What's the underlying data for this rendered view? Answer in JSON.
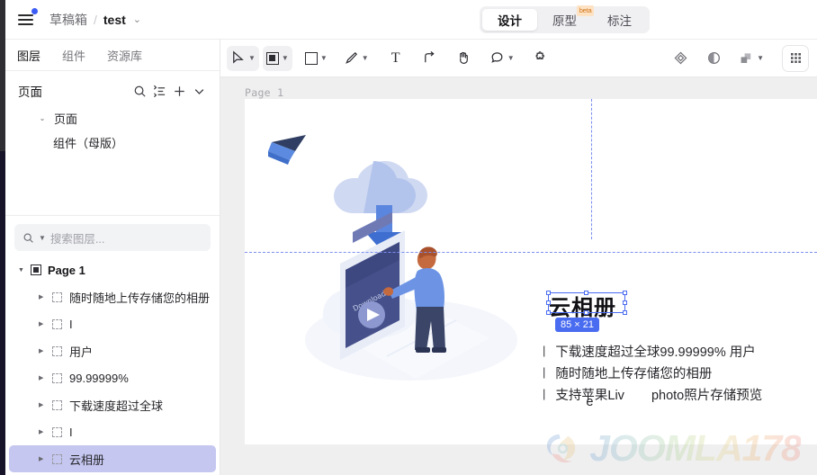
{
  "header": {
    "menu_icon": "hamburger-icon",
    "notification_dot": true,
    "breadcrumb_root": "草稿箱",
    "breadcrumb_sep": "/",
    "breadcrumb_current": "test",
    "breadcrumb_chevron": "⌄",
    "tabs": [
      {
        "label": "设计",
        "active": true,
        "badge": ""
      },
      {
        "label": "原型",
        "active": false,
        "badge": "beta"
      },
      {
        "label": "标注",
        "active": false,
        "badge": ""
      }
    ]
  },
  "left_panel": {
    "tabs": [
      {
        "label": "图层",
        "active": true
      },
      {
        "label": "组件",
        "active": false
      },
      {
        "label": "资源库",
        "active": false
      }
    ],
    "page_section": {
      "title": "页面",
      "icons": [
        "search-icon",
        "sort-list-icon",
        "plus-icon",
        "chevron-down-icon"
      ],
      "items": [
        {
          "label": "页面",
          "caret": "⌄",
          "indent": 1
        },
        {
          "label": "组件（母版）",
          "caret": "",
          "indent": 2
        }
      ]
    },
    "search": {
      "placeholder": "搜索图层...",
      "value": ""
    },
    "layer_tree": {
      "root": {
        "label": "Page 1",
        "caret": "▼"
      },
      "items": [
        {
          "label": "随时随地上传存储您的相册",
          "selected": false
        },
        {
          "label": "I",
          "selected": false
        },
        {
          "label": "用户",
          "selected": false
        },
        {
          "label": "99.99999%",
          "selected": false
        },
        {
          "label": "下载速度超过全球",
          "selected": false
        },
        {
          "label": "I",
          "selected": false
        },
        {
          "label": "云相册",
          "selected": true
        }
      ]
    }
  },
  "canvas": {
    "toolbar_left": [
      {
        "name": "select-tool",
        "glyph": "cursor",
        "caret": true,
        "active": true
      },
      {
        "name": "frame-tool",
        "glyph": "frame",
        "caret": true,
        "active": true
      },
      {
        "name": "rectangle-tool",
        "glyph": "rect",
        "caret": true,
        "active": false
      },
      {
        "name": "pen-tool",
        "glyph": "pen",
        "caret": true,
        "active": false
      },
      {
        "name": "text-tool",
        "glyph": "T",
        "caret": false,
        "active": false
      },
      {
        "name": "connector-tool",
        "glyph": "arrow",
        "caret": false,
        "active": false
      },
      {
        "name": "hand-tool",
        "glyph": "hand",
        "caret": false,
        "active": false
      },
      {
        "name": "comment-tool",
        "glyph": "blob",
        "caret": true,
        "active": false
      },
      {
        "name": "component-tool",
        "glyph": "puzzle",
        "caret": false,
        "active": false
      }
    ],
    "toolbar_right": [
      {
        "name": "mask-tool",
        "glyph": "diamond",
        "caret": false
      },
      {
        "name": "opacity-tool",
        "glyph": "contrast",
        "caret": false
      },
      {
        "name": "boolean-tool",
        "glyph": "union",
        "caret": true
      }
    ],
    "apps_button": "grid-icon",
    "frame_label": "Page 1",
    "selection": {
      "size_badge": "85 × 21",
      "target_label": "云相册"
    },
    "artboard": {
      "title": "云相册",
      "bullets": [
        {
          "bar": "|",
          "text": "下载速度超过全球99.99999% 用户",
          "wrapped": ""
        },
        {
          "bar": "|",
          "text": "随时随地上传存储您的相册",
          "wrapped": ""
        },
        {
          "bar": "|",
          "text": "支持苹果Liv",
          "wrapped": "e",
          "tail": "photo照片存储预览"
        }
      ]
    }
  },
  "watermark": {
    "text": "JOOMLA178",
    "logo": "spiral-logo-icon"
  },
  "colors": {
    "accent_blue": "#4a6cf0",
    "selection_fill": "#c5c7f0",
    "guide_blue": "#7b8ef0",
    "beta_bg": "#fde2c4",
    "beta_fg": "#d2761a"
  }
}
